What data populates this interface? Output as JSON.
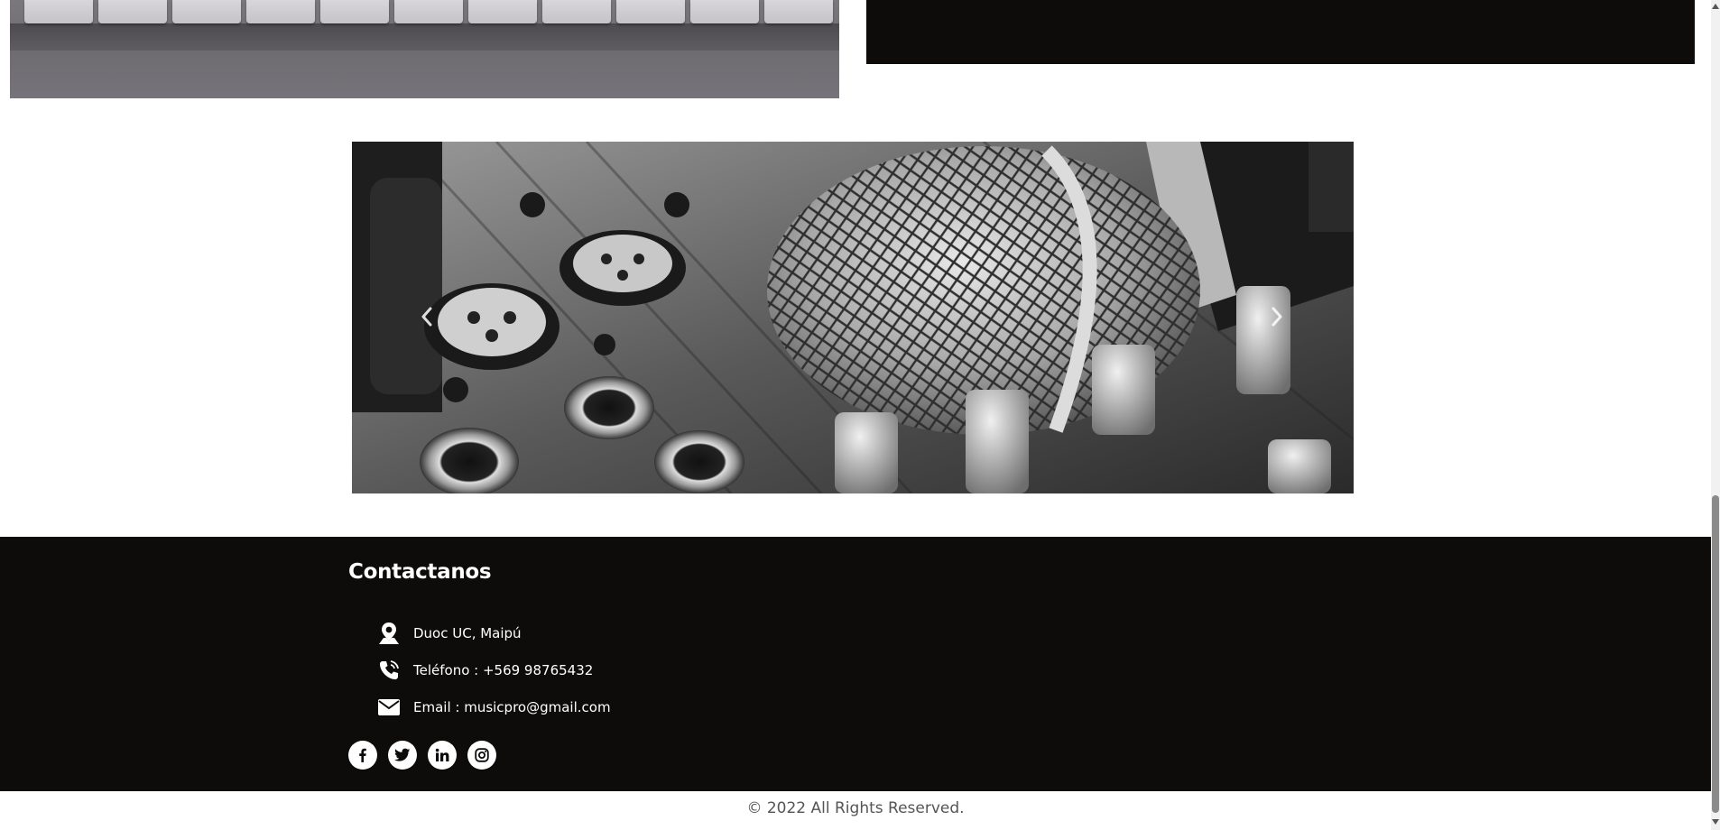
{
  "carousel": {
    "prev_icon": "chevron-left-icon",
    "next_icon": "chevron-right-icon"
  },
  "footer": {
    "title": "Contactanos",
    "contacts": [
      {
        "icon": "map-pin-icon",
        "text": "Duoc UC, Maipú"
      },
      {
        "icon": "phone-icon",
        "text": "Teléfono : +569 98765432"
      },
      {
        "icon": "envelope-icon",
        "text": "Email : musicpro@gmail.com"
      }
    ],
    "social": [
      {
        "icon": "facebook-icon",
        "name": "facebook"
      },
      {
        "icon": "twitter-icon",
        "name": "twitter"
      },
      {
        "icon": "linkedin-icon",
        "name": "linkedin"
      },
      {
        "icon": "instagram-icon",
        "name": "instagram"
      }
    ],
    "background": "#0e0c0b"
  },
  "copyright": "© 2022 All Rights Reserved."
}
